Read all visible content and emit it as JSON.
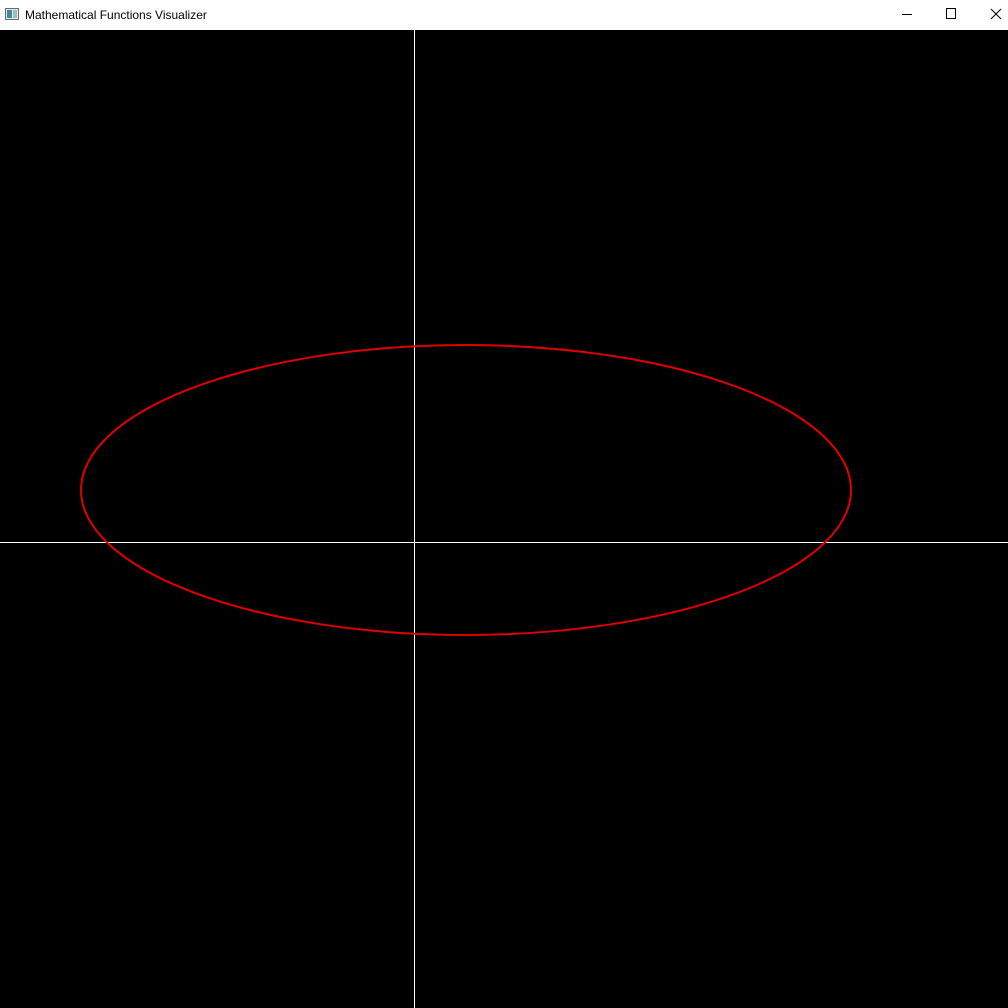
{
  "window": {
    "title": "Mathematical Functions Visualizer",
    "icons": {
      "app": "app-window-icon",
      "minimize": "minimize-icon",
      "maximize": "maximize-icon",
      "close": "close-icon"
    }
  },
  "plot": {
    "background_color": "#000000",
    "axis_color": "#ffffff",
    "curve_color": "#e00000",
    "curve_type": "ellipse"
  }
}
